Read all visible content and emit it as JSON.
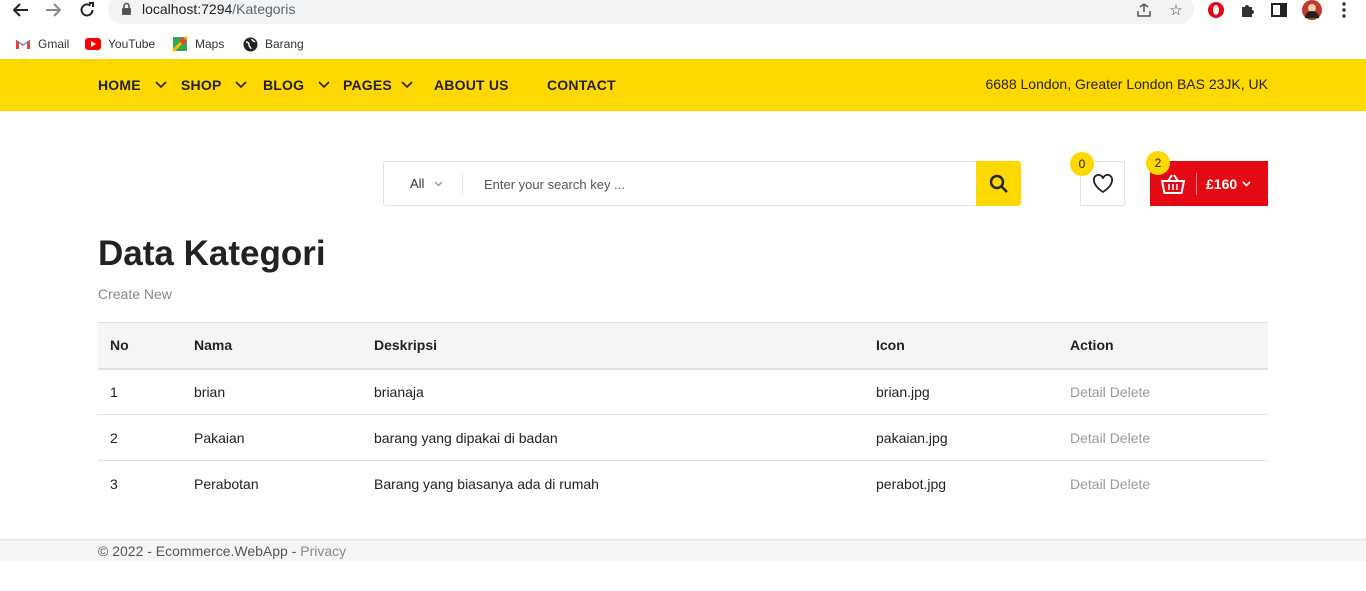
{
  "browser": {
    "url_host": "localhost:7294",
    "url_path": "/Kategoris",
    "bookmarks": [
      "Gmail",
      "YouTube",
      "Maps",
      "Barang"
    ]
  },
  "navbar": {
    "menu": [
      "HOME",
      "SHOP",
      "BLOG",
      "PAGES",
      "ABOUT US",
      "CONTACT"
    ],
    "address": "6688 London, Greater London BAS 23JK, UK"
  },
  "search": {
    "category": "All",
    "placeholder": "Enter your search key ..."
  },
  "wishlist": {
    "count": "0"
  },
  "cart": {
    "count": "2",
    "total": "£160"
  },
  "page": {
    "title": "Data Kategori",
    "create_link": "Create New"
  },
  "table": {
    "headers": [
      "No",
      "Nama",
      "Deskripsi",
      "Icon",
      "Action"
    ],
    "rows": [
      {
        "no": "1",
        "nama": "brian",
        "deskripsi": "brianaja",
        "icon": "brian.jpg",
        "detail": "Detail",
        "delete": "Delete"
      },
      {
        "no": "2",
        "nama": "Pakaian",
        "deskripsi": "barang yang dipakai di badan",
        "icon": "pakaian.jpg",
        "detail": "Detail",
        "delete": "Delete"
      },
      {
        "no": "3",
        "nama": "Perabotan",
        "deskripsi": "Barang yang biasanya ada di rumah",
        "icon": "perabot.jpg",
        "detail": "Detail",
        "delete": "Delete"
      }
    ]
  },
  "footer": {
    "copyright": "© 2022 - Ecommerce.WebApp - ",
    "privacy": "Privacy"
  },
  "colors": {
    "brand_yellow": "#ffd800",
    "cart_red": "#e50914"
  }
}
